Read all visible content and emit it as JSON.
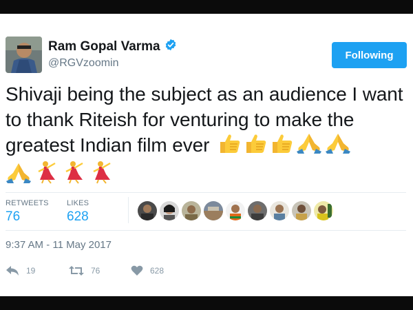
{
  "user": {
    "name": "Ram Gopal Varma",
    "handle": "@RGVzoomin"
  },
  "follow_button": {
    "label": "Following"
  },
  "tweet": {
    "text": "Shivaji being the subject as an audience I want to thank Riteish for venturing to make the greatest Indian film ever",
    "emojis": [
      "thumbs-up",
      "thumbs-up",
      "thumbs-up",
      "folded-hands",
      "folded-hands",
      "folded-hands",
      "dancer",
      "dancer",
      "dancer"
    ]
  },
  "stats": {
    "retweets_label": "RETWEETS",
    "retweets": "76",
    "likes_label": "LIKES",
    "likes": "628"
  },
  "timestamp": "9:37 AM - 11 May 2017",
  "actions": {
    "reply_count": "19",
    "retweet_count": "76",
    "like_count": "628"
  },
  "colors": {
    "accent": "#1da1f2",
    "muted": "#657786",
    "text": "#14171a"
  }
}
